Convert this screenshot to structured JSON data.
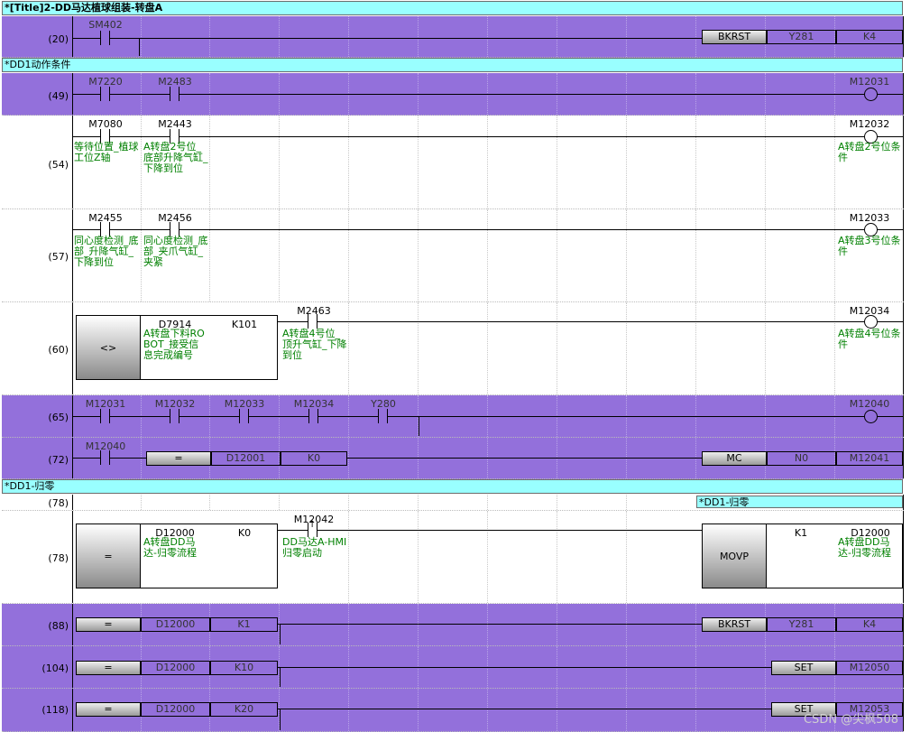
{
  "title_main": "*[Title]2-DD马达植球组装-转盘A",
  "section_dd1_action": "*DD1动作条件",
  "section_dd1_zero": "*DD1-归零",
  "sub_dd1_zero": "*DD1-归零",
  "watermark": "CSDN @尖枫508",
  "rungs": {
    "r20": {
      "step": "(20)",
      "c1": "SM402",
      "inst": "BKRST",
      "op1": "Y281",
      "op2": "K4"
    },
    "r49": {
      "step": "(49)",
      "c1": "M7220",
      "c2": "M2483",
      "coil": "M12031"
    },
    "r54": {
      "step": "(54)",
      "c1": "M7080",
      "c1_cmt": "等待位置_植球工位Z轴",
      "c2": "M2443",
      "c2_cmt": "A转盘2号位_底部升降气缸_下降到位",
      "coil": "M12032",
      "coil_cmt": "A转盘2号位条件"
    },
    "r57": {
      "step": "(57)",
      "c1": "M2455",
      "c1_cmt": "同心度检测_底部_升降气缸_下降到位",
      "c2": "M2456",
      "c2_cmt": "同心度检测_底部_夹爪气缸_夹紧",
      "coil": "M12033",
      "coil_cmt": "A转盘3号位条件"
    },
    "r60": {
      "step": "(60)",
      "cmp": "<>",
      "op1": "D7914",
      "op1_cmt": "A转盘下料ROBOT_接受信息完成编号",
      "op2": "K101",
      "c1": "M2463",
      "c1_cmt": "A转盘4号位_顶升气缸_下降到位",
      "coil": "M12034",
      "coil_cmt": "A转盘4号位条件"
    },
    "r65": {
      "step": "(65)",
      "c1": "M12031",
      "c2": "M12032",
      "c3": "M12033",
      "c4": "M12034",
      "c5": "Y280",
      "coil": "M12040"
    },
    "r72": {
      "step": "(72)",
      "c1": "M12040",
      "cmp": "=",
      "op1": "D12001",
      "op2": "K0",
      "inst": "MC",
      "iop1": "N0",
      "iop2": "M12041"
    },
    "r78a": {
      "step": "(78)"
    },
    "r78b": {
      "step": "(78)",
      "cmp": "=",
      "op1": "D12000",
      "op1_cmt": "A转盘DD马达-归零流程",
      "op2": "K0",
      "c1": "M12042",
      "c1_cmt": "DD马达A-HMI归零启动",
      "inst": "MOVP",
      "iop1": "K1",
      "iop2": "D12000",
      "iop2_cmt": "A转盘DD马达-归零流程"
    },
    "r88": {
      "step": "(88)",
      "cmp": "=",
      "op1": "D12000",
      "op2": "K1",
      "inst": "BKRST",
      "iop1": "Y281",
      "iop2": "K4"
    },
    "r104": {
      "step": "(104)",
      "cmp": "=",
      "op1": "D12000",
      "op2": "K10",
      "inst": "SET",
      "iop1": "M12050"
    },
    "r118": {
      "step": "(118)",
      "cmp": "=",
      "op1": "D12000",
      "op2": "K20",
      "inst": "SET",
      "iop1": "M12053"
    }
  },
  "colors": {
    "purple": "#9370db",
    "cyan": "#99ffff",
    "comment": "#008000"
  }
}
